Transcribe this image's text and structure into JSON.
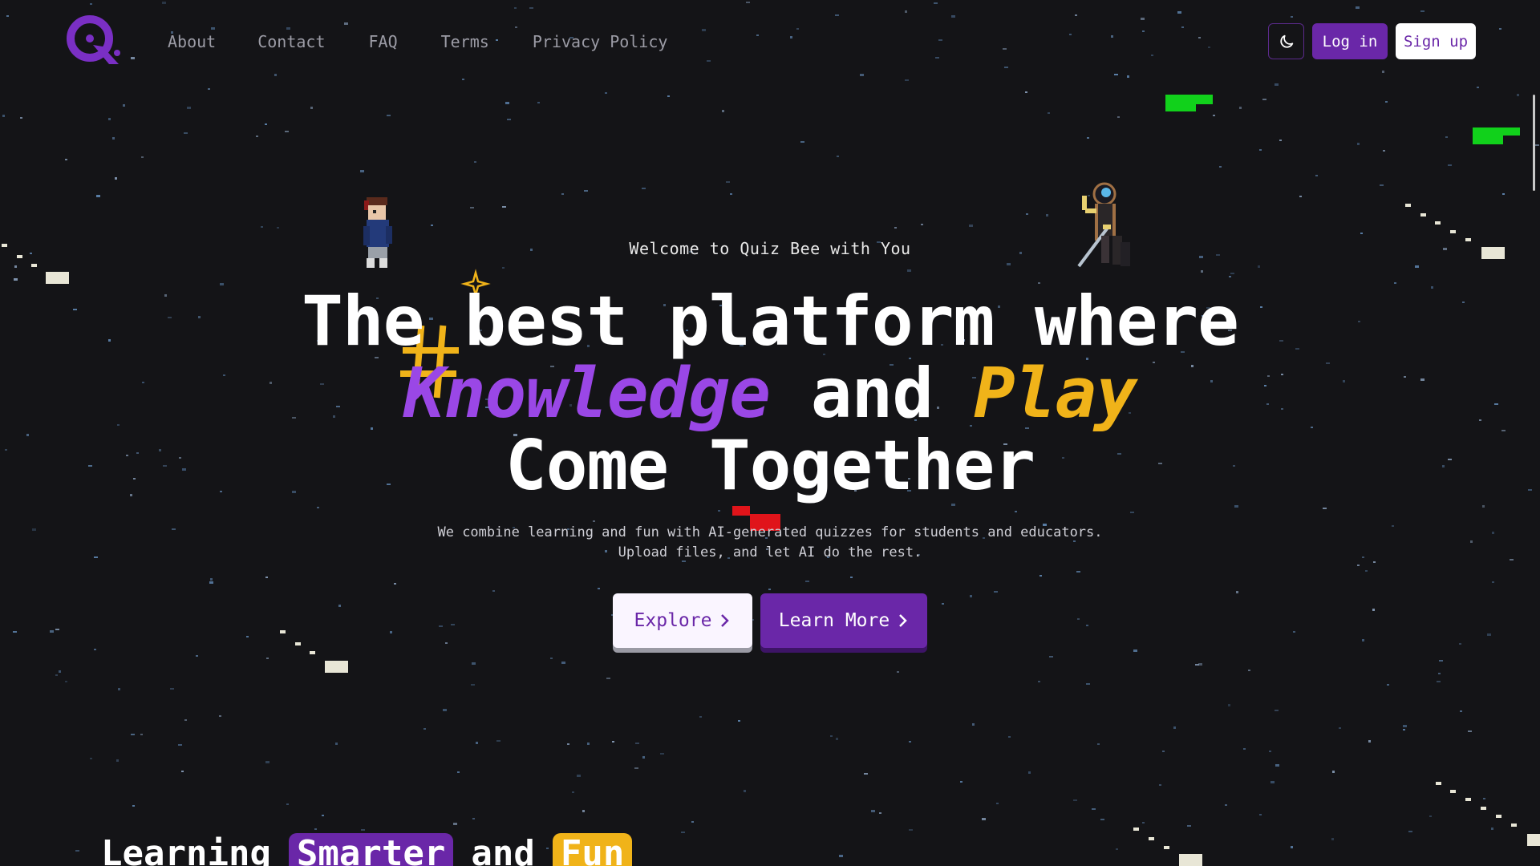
{
  "nav": {
    "links": [
      "About",
      "Contact",
      "FAQ",
      "Terms",
      "Privacy Policy"
    ],
    "theme_toggle_icon": "moon-icon",
    "login_label": "Log in",
    "signup_label": "Sign up"
  },
  "hero": {
    "welcome": "Welcome to Quiz Bee with You",
    "headline_line1": "The best platform where",
    "headline_word_knowledge": "Knowledge",
    "headline_word_and": " and ",
    "headline_word_play": "Play",
    "headline_line3": "Come Together",
    "subtitle": "We combine learning and fun with AI-generated quizzes for students and educators. Upload files, and let AI do the rest.",
    "explore_label": "Explore",
    "learn_more_label": "Learn More"
  },
  "section": {
    "word_learning": "Learning",
    "word_smarter": "Smarter",
    "word_and": "and",
    "word_fun": "Fun"
  },
  "colors": {
    "background": "#141417",
    "purple": "#6a27a8",
    "purple_light": "#9a47e6",
    "yellow": "#f0b319",
    "green_pixels": "#11d11b",
    "red_pixels": "#e0141a"
  }
}
